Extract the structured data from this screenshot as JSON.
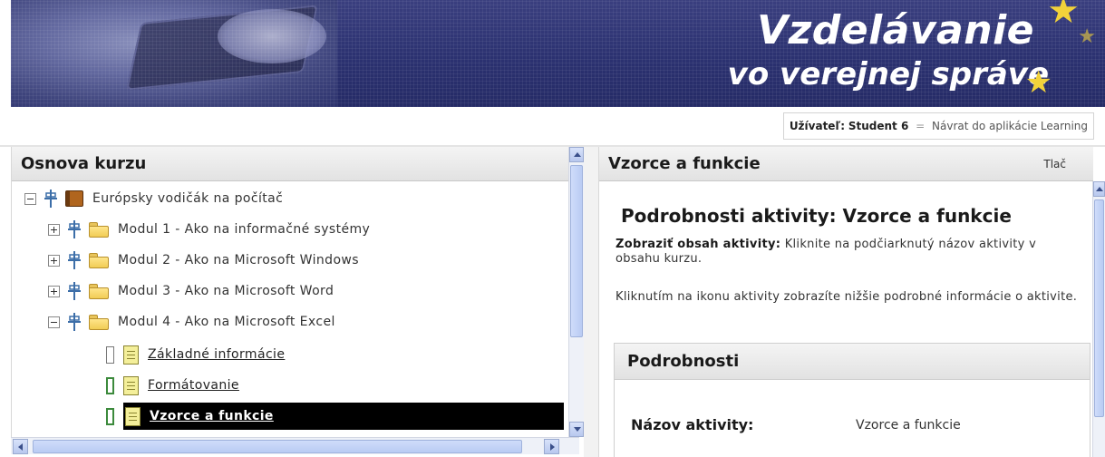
{
  "banner": {
    "title_line1": "Vzdelávanie",
    "title_line2": "vo verejnej správe",
    "colors": {
      "background": "#2b3170",
      "star": "#f2d23a"
    }
  },
  "userbar": {
    "user_label": "Užívateľ:",
    "user_name": "Student 6",
    "separator": "=",
    "return_link": "Návrat do aplikácie Learning"
  },
  "outline": {
    "title": "Osnova kurzu",
    "root": {
      "label": "Európsky vodičák na počítač",
      "icon": "book-icon"
    },
    "modules": [
      {
        "label": "Modul 1 - Ako na informačné systémy",
        "expanded": false
      },
      {
        "label": "Modul 2 - Ako na Microsoft Windows",
        "expanded": false
      },
      {
        "label": "Modul 3 - Ako na Microsoft Word",
        "expanded": false
      },
      {
        "label": "Modul 4 - Ako na Microsoft Excel",
        "expanded": true
      }
    ],
    "activities": [
      {
        "label": "Základné informácie",
        "status": "not-attempted"
      },
      {
        "label": "Formátovanie",
        "status": "attempted"
      },
      {
        "label": "Vzorce a funkcie",
        "status": "attempted",
        "selected": true
      }
    ]
  },
  "detail": {
    "header_title": "Vzorce a funkcie",
    "print_link": "Tlač",
    "heading": "Podrobnosti aktivity:  Vzorce a funkcie",
    "show_label": "Zobraziť obsah aktivity:",
    "show_text": "Kliknite na podčiarknutý názov aktivity v obsahu kurzu.",
    "info_text": "Kliknutím na ikonu aktivity zobrazíte nižšie podrobné informácie o aktivite.",
    "details_title": "Podrobnosti",
    "activity_name_label": "Názov aktivity:",
    "activity_name_value": "Vzorce a funkcie"
  }
}
